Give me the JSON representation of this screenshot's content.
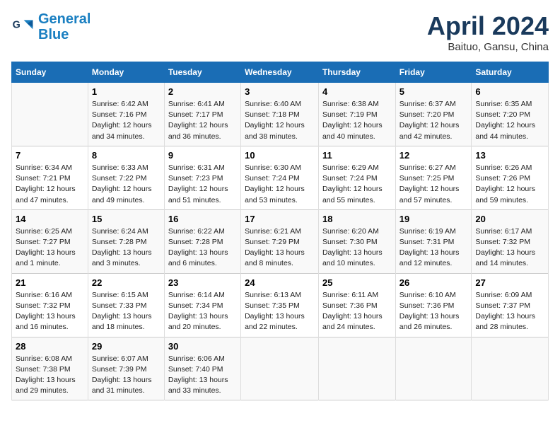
{
  "logo": {
    "line1": "General",
    "line2": "Blue"
  },
  "title": "April 2024",
  "subtitle": "Baituo, Gansu, China",
  "days_of_week": [
    "Sunday",
    "Monday",
    "Tuesday",
    "Wednesday",
    "Thursday",
    "Friday",
    "Saturday"
  ],
  "weeks": [
    [
      {
        "num": "",
        "sunrise": "",
        "sunset": "",
        "daylight": ""
      },
      {
        "num": "1",
        "sunrise": "Sunrise: 6:42 AM",
        "sunset": "Sunset: 7:16 PM",
        "daylight": "Daylight: 12 hours and 34 minutes."
      },
      {
        "num": "2",
        "sunrise": "Sunrise: 6:41 AM",
        "sunset": "Sunset: 7:17 PM",
        "daylight": "Daylight: 12 hours and 36 minutes."
      },
      {
        "num": "3",
        "sunrise": "Sunrise: 6:40 AM",
        "sunset": "Sunset: 7:18 PM",
        "daylight": "Daylight: 12 hours and 38 minutes."
      },
      {
        "num": "4",
        "sunrise": "Sunrise: 6:38 AM",
        "sunset": "Sunset: 7:19 PM",
        "daylight": "Daylight: 12 hours and 40 minutes."
      },
      {
        "num": "5",
        "sunrise": "Sunrise: 6:37 AM",
        "sunset": "Sunset: 7:20 PM",
        "daylight": "Daylight: 12 hours and 42 minutes."
      },
      {
        "num": "6",
        "sunrise": "Sunrise: 6:35 AM",
        "sunset": "Sunset: 7:20 PM",
        "daylight": "Daylight: 12 hours and 44 minutes."
      }
    ],
    [
      {
        "num": "7",
        "sunrise": "Sunrise: 6:34 AM",
        "sunset": "Sunset: 7:21 PM",
        "daylight": "Daylight: 12 hours and 47 minutes."
      },
      {
        "num": "8",
        "sunrise": "Sunrise: 6:33 AM",
        "sunset": "Sunset: 7:22 PM",
        "daylight": "Daylight: 12 hours and 49 minutes."
      },
      {
        "num": "9",
        "sunrise": "Sunrise: 6:31 AM",
        "sunset": "Sunset: 7:23 PM",
        "daylight": "Daylight: 12 hours and 51 minutes."
      },
      {
        "num": "10",
        "sunrise": "Sunrise: 6:30 AM",
        "sunset": "Sunset: 7:24 PM",
        "daylight": "Daylight: 12 hours and 53 minutes."
      },
      {
        "num": "11",
        "sunrise": "Sunrise: 6:29 AM",
        "sunset": "Sunset: 7:24 PM",
        "daylight": "Daylight: 12 hours and 55 minutes."
      },
      {
        "num": "12",
        "sunrise": "Sunrise: 6:27 AM",
        "sunset": "Sunset: 7:25 PM",
        "daylight": "Daylight: 12 hours and 57 minutes."
      },
      {
        "num": "13",
        "sunrise": "Sunrise: 6:26 AM",
        "sunset": "Sunset: 7:26 PM",
        "daylight": "Daylight: 12 hours and 59 minutes."
      }
    ],
    [
      {
        "num": "14",
        "sunrise": "Sunrise: 6:25 AM",
        "sunset": "Sunset: 7:27 PM",
        "daylight": "Daylight: 13 hours and 1 minute."
      },
      {
        "num": "15",
        "sunrise": "Sunrise: 6:24 AM",
        "sunset": "Sunset: 7:28 PM",
        "daylight": "Daylight: 13 hours and 3 minutes."
      },
      {
        "num": "16",
        "sunrise": "Sunrise: 6:22 AM",
        "sunset": "Sunset: 7:28 PM",
        "daylight": "Daylight: 13 hours and 6 minutes."
      },
      {
        "num": "17",
        "sunrise": "Sunrise: 6:21 AM",
        "sunset": "Sunset: 7:29 PM",
        "daylight": "Daylight: 13 hours and 8 minutes."
      },
      {
        "num": "18",
        "sunrise": "Sunrise: 6:20 AM",
        "sunset": "Sunset: 7:30 PM",
        "daylight": "Daylight: 13 hours and 10 minutes."
      },
      {
        "num": "19",
        "sunrise": "Sunrise: 6:19 AM",
        "sunset": "Sunset: 7:31 PM",
        "daylight": "Daylight: 13 hours and 12 minutes."
      },
      {
        "num": "20",
        "sunrise": "Sunrise: 6:17 AM",
        "sunset": "Sunset: 7:32 PM",
        "daylight": "Daylight: 13 hours and 14 minutes."
      }
    ],
    [
      {
        "num": "21",
        "sunrise": "Sunrise: 6:16 AM",
        "sunset": "Sunset: 7:32 PM",
        "daylight": "Daylight: 13 hours and 16 minutes."
      },
      {
        "num": "22",
        "sunrise": "Sunrise: 6:15 AM",
        "sunset": "Sunset: 7:33 PM",
        "daylight": "Daylight: 13 hours and 18 minutes."
      },
      {
        "num": "23",
        "sunrise": "Sunrise: 6:14 AM",
        "sunset": "Sunset: 7:34 PM",
        "daylight": "Daylight: 13 hours and 20 minutes."
      },
      {
        "num": "24",
        "sunrise": "Sunrise: 6:13 AM",
        "sunset": "Sunset: 7:35 PM",
        "daylight": "Daylight: 13 hours and 22 minutes."
      },
      {
        "num": "25",
        "sunrise": "Sunrise: 6:11 AM",
        "sunset": "Sunset: 7:36 PM",
        "daylight": "Daylight: 13 hours and 24 minutes."
      },
      {
        "num": "26",
        "sunrise": "Sunrise: 6:10 AM",
        "sunset": "Sunset: 7:36 PM",
        "daylight": "Daylight: 13 hours and 26 minutes."
      },
      {
        "num": "27",
        "sunrise": "Sunrise: 6:09 AM",
        "sunset": "Sunset: 7:37 PM",
        "daylight": "Daylight: 13 hours and 28 minutes."
      }
    ],
    [
      {
        "num": "28",
        "sunrise": "Sunrise: 6:08 AM",
        "sunset": "Sunset: 7:38 PM",
        "daylight": "Daylight: 13 hours and 29 minutes."
      },
      {
        "num": "29",
        "sunrise": "Sunrise: 6:07 AM",
        "sunset": "Sunset: 7:39 PM",
        "daylight": "Daylight: 13 hours and 31 minutes."
      },
      {
        "num": "30",
        "sunrise": "Sunrise: 6:06 AM",
        "sunset": "Sunset: 7:40 PM",
        "daylight": "Daylight: 13 hours and 33 minutes."
      },
      {
        "num": "",
        "sunrise": "",
        "sunset": "",
        "daylight": ""
      },
      {
        "num": "",
        "sunrise": "",
        "sunset": "",
        "daylight": ""
      },
      {
        "num": "",
        "sunrise": "",
        "sunset": "",
        "daylight": ""
      },
      {
        "num": "",
        "sunrise": "",
        "sunset": "",
        "daylight": ""
      }
    ]
  ]
}
